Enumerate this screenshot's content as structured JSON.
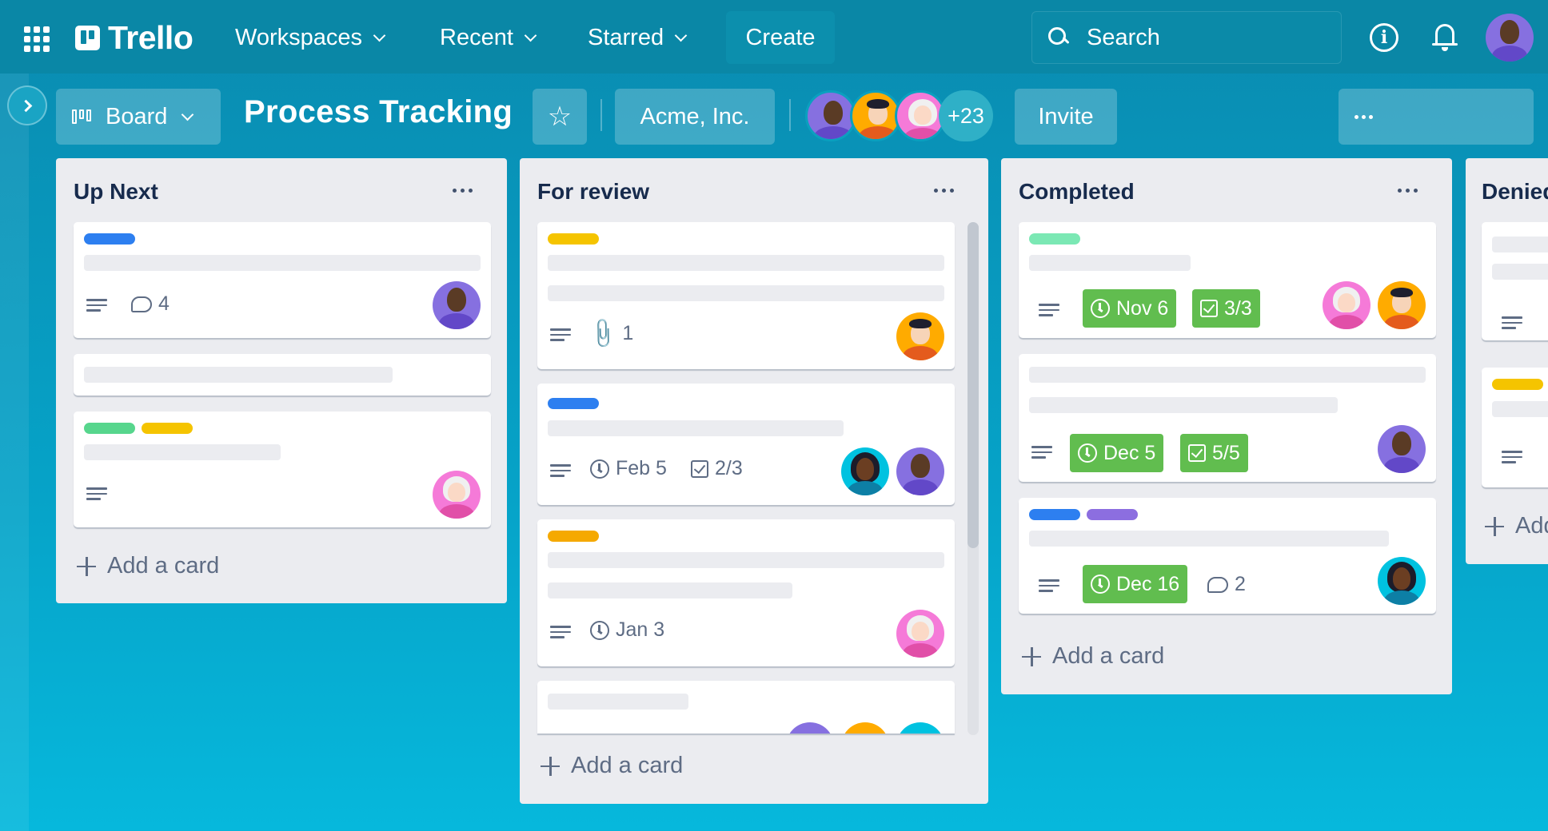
{
  "topnav": {
    "brand": "Trello",
    "workspaces": "Workspaces",
    "recent": "Recent",
    "starred": "Starred",
    "create": "Create",
    "search_placeholder": "Search"
  },
  "board": {
    "view": "Board",
    "title": "Process Tracking",
    "workspace": "Acme, Inc.",
    "extra_members": "+23",
    "invite": "Invite"
  },
  "lists": [
    {
      "title": "Up Next",
      "add_card": "Add a card",
      "cards": [
        {
          "comments": "4"
        },
        {},
        {}
      ]
    },
    {
      "title": "For review",
      "add_card": "Add a card",
      "cards": [
        {
          "attachments": "1"
        },
        {
          "due": "Feb 5",
          "checklist": "2/3"
        },
        {
          "due": "Jan 3"
        },
        {}
      ]
    },
    {
      "title": "Completed",
      "add_card": "Add a card",
      "cards": [
        {
          "due": "Nov 6",
          "checklist": "3/3"
        },
        {
          "due": "Dec 5",
          "checklist": "5/5"
        },
        {
          "due": "Dec 16",
          "comments": "2"
        }
      ]
    },
    {
      "title": "Denied",
      "add_card": "Add a card"
    }
  ],
  "colors": {
    "label_blue": "#2d7ff0",
    "label_yellow": "#f5c400",
    "label_orange": "#f5a900",
    "label_green": "#57d68d",
    "label_mint": "#7be8b4",
    "label_purple": "#8c6ee0",
    "due_complete_green": "#61bd4f"
  }
}
